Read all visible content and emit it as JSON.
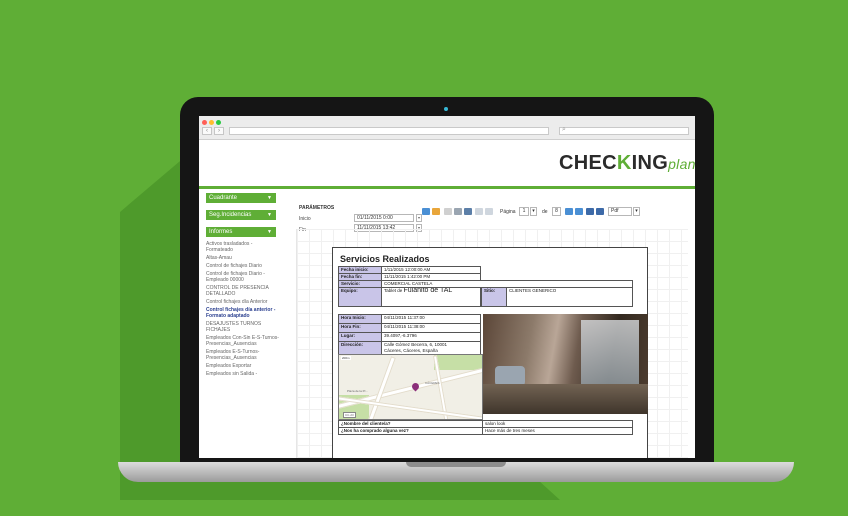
{
  "colors": {
    "brand_green": "#5fae36",
    "label_purple": "#c9c5e8",
    "link_blue": "#2a3f8f"
  },
  "logo": {
    "part1": "CHEC",
    "part2": "K",
    "part3": "ING",
    "plan": "plan"
  },
  "sidebar": {
    "sections": [
      {
        "label": "Cuadrante",
        "icon": "chevron-down-icon"
      },
      {
        "label": "Seg.Incidencias",
        "icon": "chevron-down-icon"
      },
      {
        "label": "Informes",
        "icon": "chevron-down-icon"
      }
    ],
    "items": [
      "Activos trasladados - Formateado",
      "Altas-Amau",
      "Control de fichajes Diario",
      "Control de fichajes Diario - Empleado 00000",
      "CONTROL DE PRESENCIA DETALLADO",
      "Control fichajes día Anterior",
      "Control fichajes día anterior - Formato adaptado",
      "DESAJUSTES TURNOS FICHAJES",
      "Empleados Con-Sin E-S-Turnos-Presencias_Ausencias",
      "Empleados E-S-Turnos-Presencias_Ausencias",
      "Empleados Exportar",
      "Empleados sin Salida -"
    ],
    "active_index": 6
  },
  "parameters": {
    "title": "PARÁMETROS",
    "inicio_label": "Inicio",
    "inicio_value": "01/11/2015 0:00",
    "fin_label": "Fin",
    "fin_value": "11/11/2015 13:42"
  },
  "toolbar": {
    "page_label": "Página",
    "page_value": "1",
    "of_label": "de",
    "total_pages": "8",
    "format": "Pdf"
  },
  "report": {
    "title": "Servicios Realizados",
    "rows": [
      {
        "label": "Fecha inicio:",
        "value": "1/11/2015 12:00:00 AM"
      },
      {
        "label": "Fecha fin:",
        "value": "11/11/2015 1:42:00 PM"
      },
      {
        "label": "Servicio:",
        "value": "COMERCIAL CASTELA"
      }
    ],
    "equipo_label": "Equipo:",
    "equipo_prefix": "Tablet de",
    "equipo_name": "Fulanito de TAL",
    "sitio_label": "Sitio:",
    "sitio_value": "CLIENTES GENERICO",
    "detail_rows": [
      {
        "label": "Hora Inicio:",
        "value": "04/11/2015 11:37:00"
      },
      {
        "label": "Hora Fin:",
        "value": "04/11/2015 11:38:00"
      },
      {
        "label": "Lugar:",
        "value": "39.4097,-6.3796"
      }
    ],
    "direccion_label": "Dirección:",
    "direccion_line1": "Calle Gómez Becerra, 6, 10001",
    "direccion_line2": "Cáceres, Cáceres, España",
    "questions": [
      {
        "label": "¿Nombre del cliente/a?",
        "value": "salon look"
      },
      {
        "label": "¿Nos ha comprado alguna vez?",
        "value": "Hace más de tres meses"
      }
    ],
    "map": {
      "scale": "200m",
      "label_a": "CÁCERES",
      "label_b": "Plaza de la Pr...",
      "badge": "CC-23"
    }
  }
}
